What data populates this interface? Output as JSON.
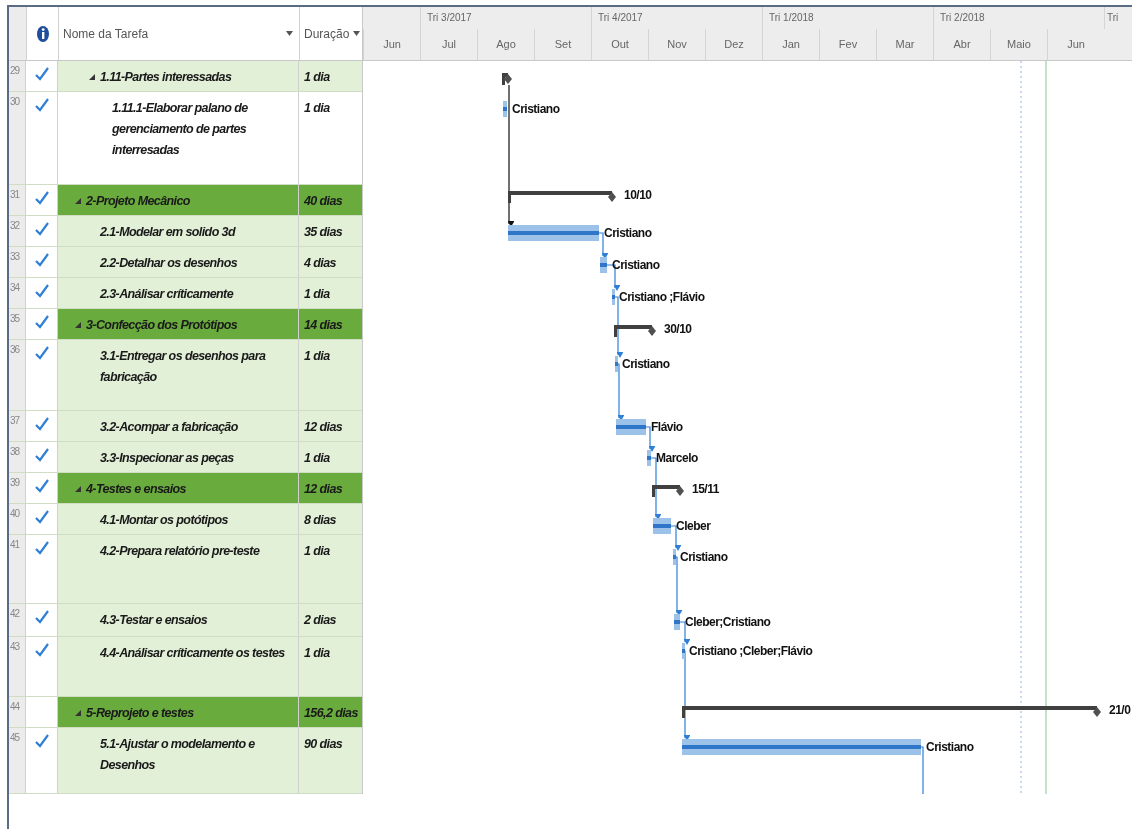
{
  "table": {
    "columns": [
      "Nome da Tarefa",
      "Duração"
    ]
  },
  "timescale": {
    "quarters": [
      "Tri 3/2017",
      "Tri 4/2017",
      "Tri 1/2018",
      "Tri 2/2018",
      "Tri"
    ],
    "months": [
      "Jun",
      "Jul",
      "Ago",
      "Set",
      "Out",
      "Nov",
      "Dez",
      "Jan",
      "Fev",
      "Mar",
      "Abr",
      "Maio",
      "Jun"
    ]
  },
  "tasks": [
    {
      "id": "29",
      "done": true,
      "kind": "group",
      "expanded": true,
      "name": "1.11-Partes interessadas",
      "duration": "1 dia",
      "children": [
        {
          "id": "30",
          "done": true,
          "kind": "task",
          "name": "1.11.1-Elaborar palano de gerenciamento de partes interresadas",
          "duration": "1 dia",
          "bar_label": "Cristiano"
        }
      ]
    },
    {
      "id": "31",
      "done": true,
      "kind": "phase",
      "expanded": true,
      "name": "2-Projeto Mecânico",
      "duration": "40 dias",
      "bar_label": "10/10",
      "children": [
        {
          "id": "32",
          "done": true,
          "kind": "task",
          "name": "2.1-Modelar em solido 3d",
          "duration": "35 dias",
          "bar_label": "Cristiano"
        },
        {
          "id": "33",
          "done": true,
          "kind": "task",
          "name": "2.2-Detalhar os desenhos",
          "duration": "4 dias",
          "bar_label": "Cristiano"
        },
        {
          "id": "34",
          "done": true,
          "kind": "task",
          "name": "2.3-Análisar críticamente",
          "duration": "1 dia",
          "bar_label": "Cristiano ;Flávio"
        }
      ]
    },
    {
      "id": "35",
      "done": true,
      "kind": "phase",
      "expanded": true,
      "name": "3-Confecção dos Protótipos",
      "duration": "14 dias",
      "bar_label": "30/10",
      "children": [
        {
          "id": "36",
          "done": true,
          "kind": "task",
          "name": "3.1-Entregar os desenhos para fabricação",
          "duration": "1 dia",
          "bar_label": "Cristiano"
        },
        {
          "id": "37",
          "done": true,
          "kind": "task",
          "name": "3.2-Acompar a fabricação",
          "duration": "12 dias",
          "bar_label": "Flávio"
        },
        {
          "id": "38",
          "done": true,
          "kind": "task",
          "name": "3.3-Inspecionar as peças",
          "duration": "1 dia",
          "bar_label": "Marcelo"
        }
      ]
    },
    {
      "id": "39",
      "done": true,
      "kind": "phase",
      "expanded": true,
      "name": "4-Testes e ensaios",
      "duration": "12 dias",
      "bar_label": "15/11",
      "children": [
        {
          "id": "40",
          "done": true,
          "kind": "task",
          "name": "4.1-Montar os potótipos",
          "duration": "8 dias",
          "bar_label": "Cleber"
        },
        {
          "id": "41",
          "done": true,
          "kind": "task",
          "name": "4.2-Prepara relatório pre-teste",
          "duration": "1 dia",
          "bar_label": "Cristiano"
        },
        {
          "id": "42",
          "done": true,
          "kind": "task",
          "name": "4.3-Testar e ensaios",
          "duration": "2 dias",
          "bar_label": "Cleber;Cristiano"
        },
        {
          "id": "43",
          "done": true,
          "kind": "task",
          "name": "4.4-Análisar críticamente os testes",
          "duration": "1 dia",
          "bar_label": "Cristiano ;Cleber;Flávio"
        }
      ]
    },
    {
      "id": "44",
      "done": false,
      "kind": "phase",
      "expanded": true,
      "name": "5-Reprojeto e testes",
      "duration": "156,2 dias",
      "bar_label": "21/0",
      "children": [
        {
          "id": "45",
          "done": true,
          "kind": "task",
          "name": "5.1-Ajustar o modelamento e Desenhos",
          "duration": "90 dias",
          "bar_label": "Cristiano"
        }
      ]
    }
  ]
}
